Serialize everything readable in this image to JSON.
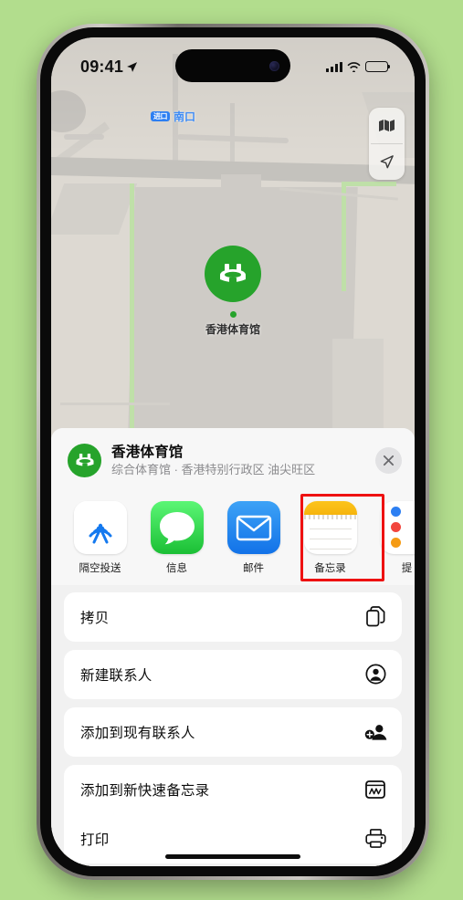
{
  "status_bar": {
    "time": "09:41",
    "location_icon": "location-arrow-icon",
    "signal_icon": "cellular-bars-icon",
    "wifi_icon": "wifi-icon",
    "battery_icon": "battery-icon"
  },
  "map": {
    "transit_badge": "进口",
    "transit_label": "南口",
    "pin_label": "香港体育馆",
    "pin_icon": "stadium-icon",
    "controls": [
      {
        "name": "map-mode-button",
        "icon": "folded-map-icon"
      },
      {
        "name": "locate-me-button",
        "icon": "navigation-arrow-icon"
      }
    ]
  },
  "share_sheet": {
    "header": {
      "title": "香港体育馆",
      "subtitle": "综合体育馆 · 香港特别行政区 油尖旺区",
      "icon": "stadium-icon",
      "close_label": "✕"
    },
    "apps": [
      {
        "label": "隔空投送",
        "icon": "airdrop-icon",
        "highlighted": false
      },
      {
        "label": "信息",
        "icon": "messages-icon",
        "highlighted": false
      },
      {
        "label": "邮件",
        "icon": "mail-icon",
        "highlighted": false
      },
      {
        "label": "备忘录",
        "icon": "notes-icon",
        "highlighted": true
      },
      {
        "label": "提",
        "icon": "reminders-icon",
        "highlighted": false
      }
    ],
    "actions": [
      {
        "label": "拷贝",
        "icon": "copy-icon"
      },
      {
        "label": "新建联系人",
        "icon": "person-circle-icon"
      },
      {
        "label": "添加到现有联系人",
        "icon": "person-add-icon"
      },
      {
        "label": "添加到新快速备忘录",
        "icon": "quick-note-icon"
      },
      {
        "label": "打印",
        "icon": "printer-icon"
      }
    ]
  },
  "colors": {
    "page_background": "#b2dd8d",
    "highlight": "#ee1111",
    "map_pin_green": "#26a32b",
    "transit_blue": "#3d8bf5"
  }
}
